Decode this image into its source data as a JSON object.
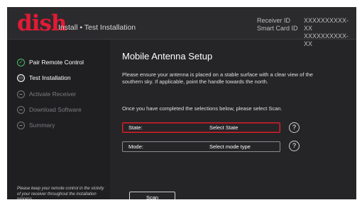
{
  "header": {
    "logo": "dish",
    "title": "Install • Test Installation",
    "info_labels": [
      "Receiver ID",
      "Smart Card ID"
    ],
    "info_values": [
      "XXXXXXXXXX-XX",
      "XXXXXXXXXX-XX"
    ]
  },
  "sidebar": {
    "steps": [
      {
        "label": "Pair Remote Control",
        "status": "done",
        "icon": "check-circle-icon"
      },
      {
        "label": "Test Installation",
        "status": "active",
        "icon": "ellipsis-circle-icon"
      },
      {
        "label": "Activate Receiver",
        "status": "pending",
        "icon": "dash-circle-icon"
      },
      {
        "label": "Download Software",
        "status": "pending",
        "icon": "dash-circle-icon"
      },
      {
        "label": "Summary",
        "status": "pending",
        "icon": "dash-circle-icon"
      }
    ],
    "note": "Please keep your remote control in the vicinity of your receiver throughout the installation process."
  },
  "main": {
    "title": "Mobile Antenna Setup",
    "instructions": "Please ensure your antenna is placed on a stable surface with a clear view of the southern sky.  If applicable, point the handle towards the north.",
    "prompt": "Once you have completed the selections below, please select Scan.",
    "fields": [
      {
        "label": "State:",
        "value": "Select State",
        "selected": true
      },
      {
        "label": "Mode:",
        "value": "Select mode type",
        "selected": false
      }
    ],
    "help_symbol": "?",
    "scan_label": "Scan"
  },
  "colors": {
    "brand_red": "#e21a35",
    "selection_border": "#d3232e",
    "done_green": "#4cc06a",
    "background": "#252528"
  }
}
